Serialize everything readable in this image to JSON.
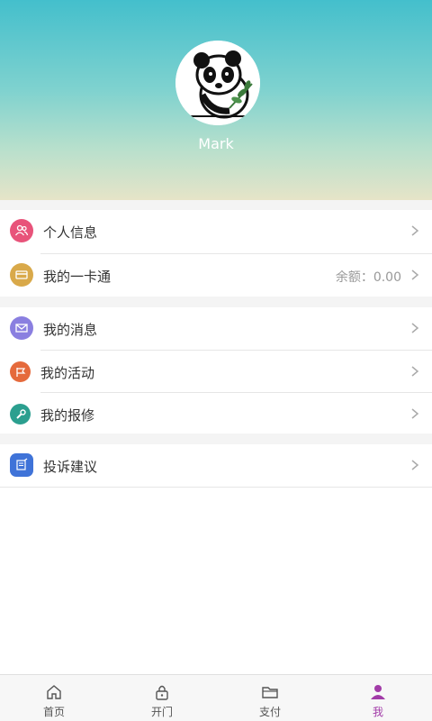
{
  "profile": {
    "username": "Mark"
  },
  "menu": {
    "personal_info": "个人信息",
    "card": "我的一卡通",
    "card_balance": "余额：0.00",
    "messages": "我的消息",
    "activities": "我的活动",
    "repairs": "我的报修",
    "complaints": "投诉建议"
  },
  "tabs": [
    {
      "label": "首页"
    },
    {
      "label": "开门"
    },
    {
      "label": "支付"
    },
    {
      "label": "我"
    }
  ],
  "colors": {
    "active_tab": "#a23ca8",
    "personal_info_icon": "#e8537a",
    "card_icon": "#d9a94a",
    "messages_icon": "#8a7fe0",
    "activities_icon": "#e56a3c",
    "repairs_icon": "#2b9f8f",
    "complaints_icon": "#3f73d8"
  }
}
